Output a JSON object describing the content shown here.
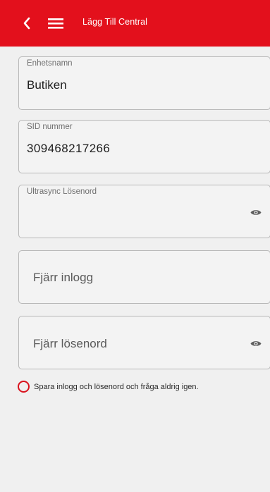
{
  "header": {
    "title": "Lägg Till Central",
    "back_icon": "chevron-left-icon",
    "menu_icon": "hamburger-menu-icon"
  },
  "form": {
    "device_name": {
      "label": "Enhetsnamn",
      "value": "Butiken"
    },
    "sid_number": {
      "label": "SID nummer",
      "value": "309468217266"
    },
    "ultrasync_password": {
      "label": "Ultrasync Lösenord",
      "value": "",
      "icon": "eye-icon"
    },
    "remote_login": {
      "placeholder": "Fjärr inlogg"
    },
    "remote_password": {
      "placeholder": "Fjärr lösenord",
      "icon": "eye-icon"
    },
    "save_credentials": {
      "label": "Spara inlogg och lösenord och fråga aldrig igen.",
      "checked": false
    }
  },
  "colors": {
    "header_bg": "#e3101c",
    "accent": "#d9121d",
    "background": "#f0f0f0"
  }
}
